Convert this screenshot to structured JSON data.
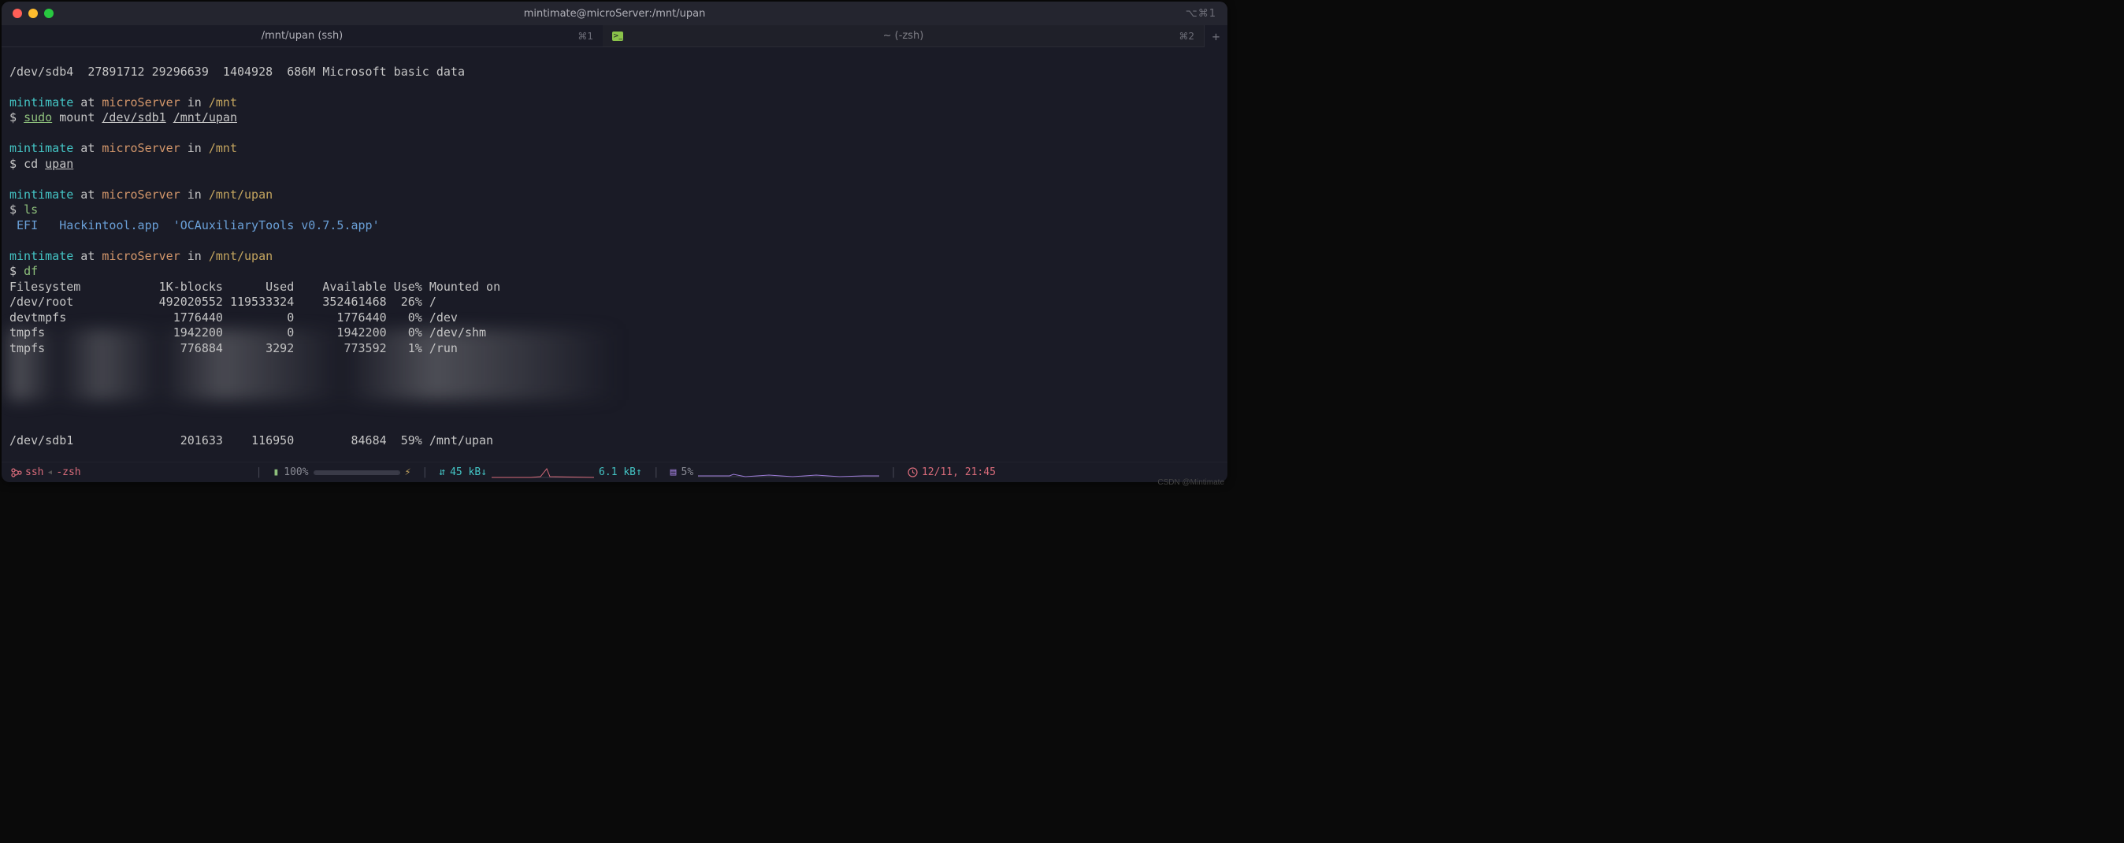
{
  "titlebar": {
    "title": "mintimate@microServer:/mnt/upan",
    "right_shortcut": "⌥⌘1"
  },
  "tabs": [
    {
      "label": "/mnt/upan (ssh)",
      "kbd": "⌘1",
      "active": true
    },
    {
      "label": "~ (-zsh)",
      "kbd": "⌘2",
      "active": false
    }
  ],
  "term": {
    "line1": "/dev/sdb4  27891712 29296639  1404928  686M Microsoft basic data",
    "prompt_user": "mintimate",
    "prompt_at": " at ",
    "prompt_host": "microServer",
    "prompt_in": " in ",
    "path_mnt": "/mnt",
    "path_mnt_upan": "/mnt/upan",
    "ps": "$ ",
    "sudo": "sudo",
    "mount": " mount ",
    "dev_sdb1": "/dev/sdb1",
    "mnt_upan_arg": "/mnt/upan",
    "cd": "cd ",
    "upan": "upan",
    "ls": "ls",
    "ls_out_efi": " EFI   ",
    "ls_out_hack": "Hackintool.app  ",
    "ls_out_oc": "'OCAuxiliaryTools v0.7.5.app'",
    "df": "df",
    "df_header": "Filesystem           1K-blocks      Used    Available Use% Mounted on",
    "df_row1": "/dev/root            492020552 119533324    352461468  26% /",
    "df_row2": "devtmpfs               1776440         0      1776440   0% /dev",
    "df_row3": "tmpfs                  1942200         0      1942200   0% /dev/shm",
    "df_row4": "tmpfs                   776884      3292       773592   1% /run",
    "df_last": "/dev/sdb1               201633    116950        84684  59% /mnt/upan"
  },
  "status": {
    "ssh": "ssh",
    "zsh": "-zsh",
    "battery_icon": "🔋",
    "battery": "100%",
    "net_down": "45 kB↓",
    "net_up": "6.1 kB↑",
    "cpu": "5%",
    "clock": "12/11, 21:45"
  },
  "watermark": "CSDN @Mintimate"
}
